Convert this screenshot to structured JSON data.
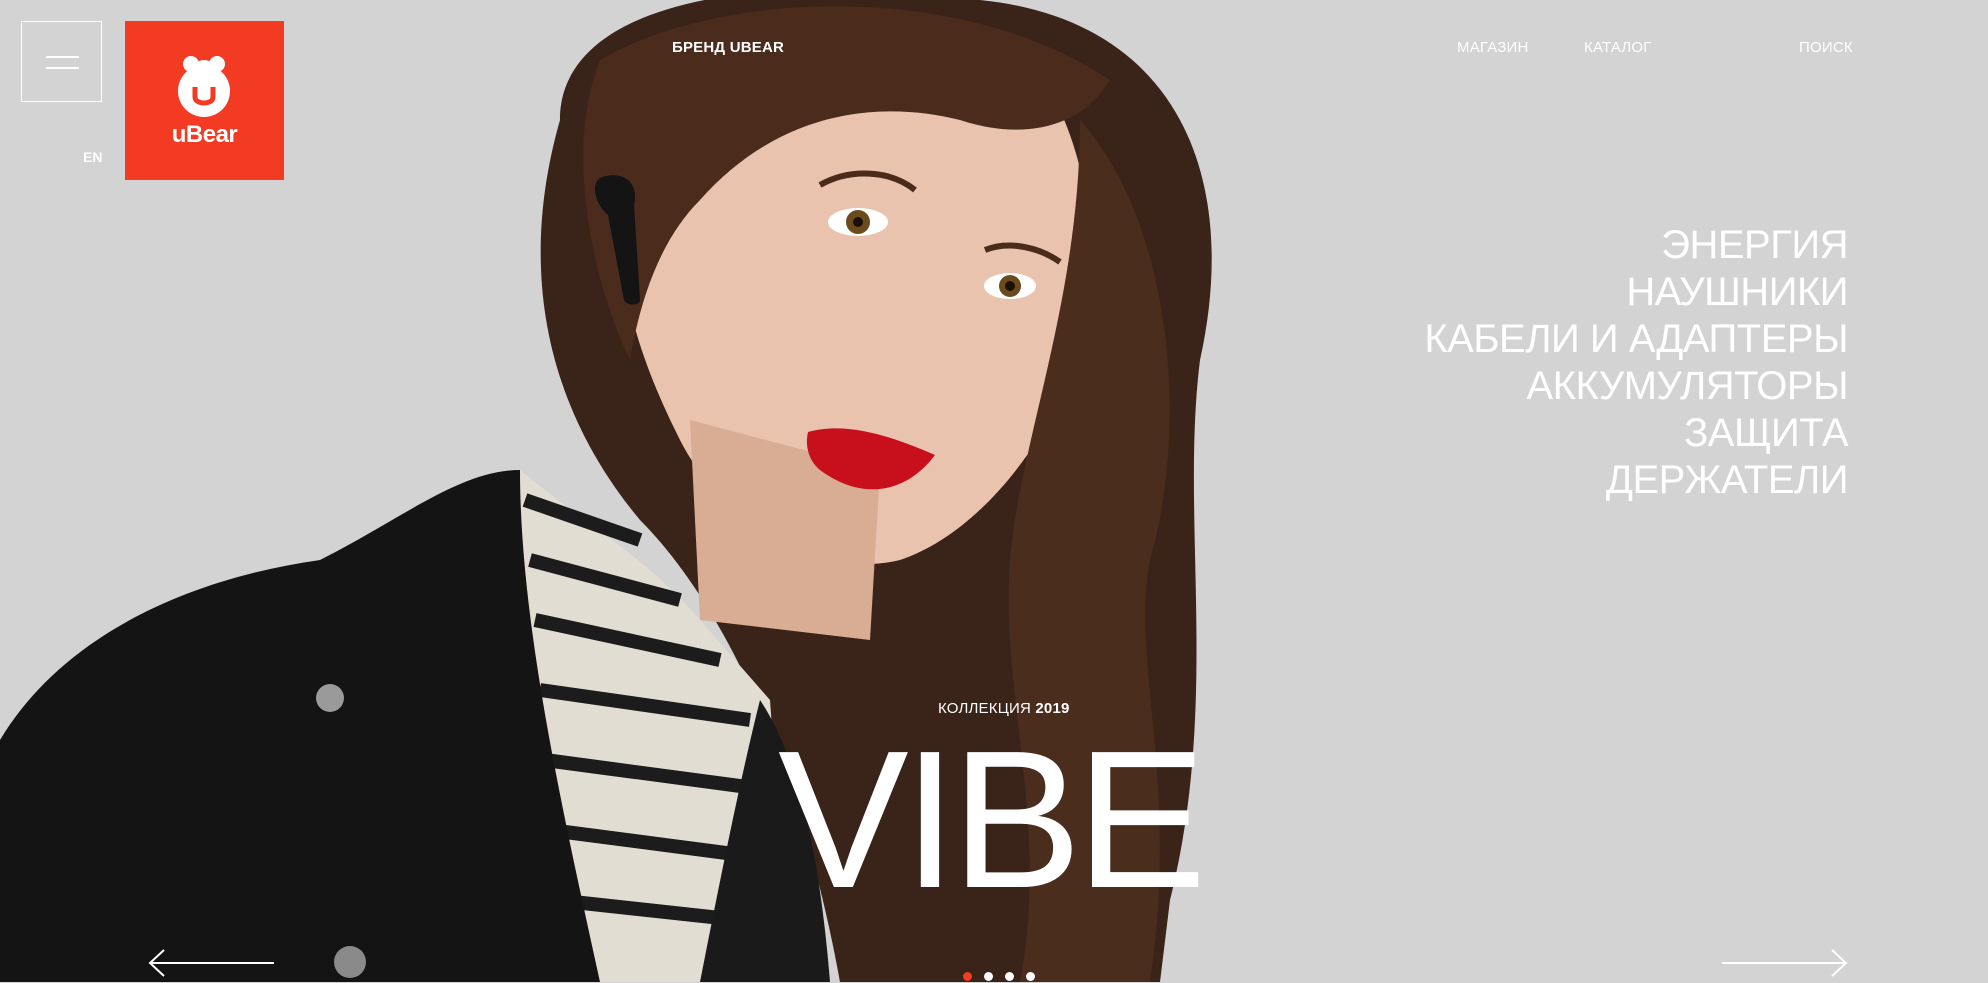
{
  "header": {
    "brand_nav_prefix": "БРЕНД",
    "brand_nav_name": "UBEAR",
    "nav": {
      "shop": "МАГАЗИН",
      "catalog": "КАТАЛОГ",
      "search": "ПОИСК"
    },
    "language": "EN",
    "logo_text": "uBear",
    "menu_icon": "hamburger-icon"
  },
  "categories": [
    "ЭНЕРГИЯ",
    "НАУШНИКИ",
    "КАБЕЛИ И АДАПТЕРЫ",
    "АККУМУЛЯТОРЫ",
    "ЗАЩИТА",
    "ДЕРЖАТЕЛИ"
  ],
  "hero": {
    "collection_label": "КОЛЛЕКЦИЯ",
    "collection_year": "2019",
    "title": "VIBE"
  },
  "slider": {
    "slides": 4,
    "active_index": 0
  },
  "colors": {
    "brand": "#f33a22",
    "background": "#d3d3d3",
    "text": "#ffffff"
  }
}
